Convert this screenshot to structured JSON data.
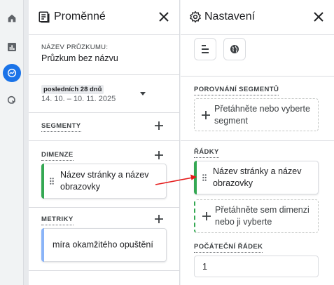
{
  "variables_panel": {
    "title": "Proměnné",
    "survey_name_label": "NÁZEV PRŮZKUMU:",
    "survey_name": "Průzkum bez názvu",
    "date_range_label": "posledních 28 dnů",
    "date_range": "14. 10. – 10. 11. 2025",
    "segments_label": "SEGMENTY",
    "dimensions_label": "DIMENZE",
    "dimension_item": "Název stránky a název obrazovky",
    "metrics_label": "METRIKY",
    "metric_item": "míra okamžitého opuštění"
  },
  "settings_panel": {
    "title": "Nastavení",
    "segment_comparison_label": "POROVNÁNÍ SEGMENTŮ",
    "segment_dropzone": "Přetáhněte nebo vyberte segment",
    "rows_label": "ŘÁDKY",
    "row_item": "Název stránky a název obrazovky",
    "row_dropzone": "Přetáhněte sem dimenzi nebo ji vyberte",
    "start_row_label": "POČÁTEČNÍ ŘÁDEK",
    "start_row_value": "1"
  },
  "colors": {
    "dimension_accent": "#34a853",
    "metric_accent": "#8ab4f8",
    "active_rail": "#1a73e8",
    "arrow": "#e51b1b"
  },
  "icons": {
    "rail": [
      "home-icon",
      "reports-icon",
      "explore-icon",
      "advertising-icon"
    ],
    "settings_tools": [
      "table-format-icon",
      "globe-icon"
    ]
  }
}
